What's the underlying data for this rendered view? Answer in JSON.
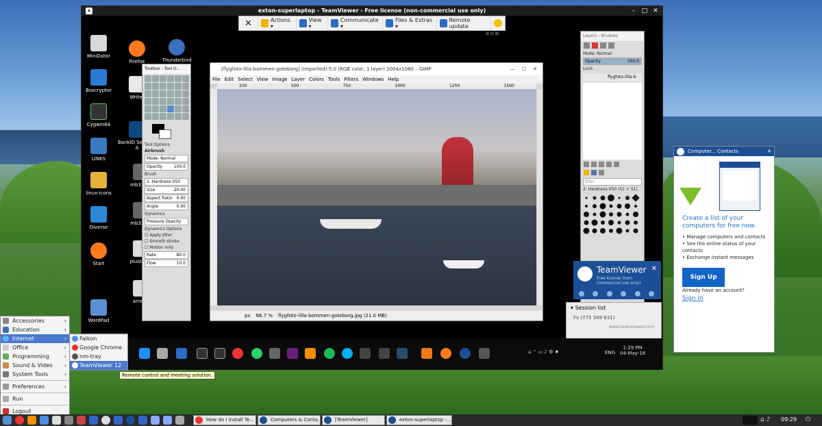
{
  "remote_window": {
    "title": "exton-superlaptop - TeamViewer - Free license (non-commercial use only)",
    "toolbar": {
      "close": "✕",
      "actions": "Actions ▾",
      "view": "View ▾",
      "communicate": "Communicate ▾",
      "files": "Files & Extras ▾",
      "update": "Remote update"
    }
  },
  "desktop_icons": [
    "MiniDator",
    "Boxcryptor",
    "Cygwin64",
    "LINKS",
    "linux-icons",
    "Diverse",
    "Start",
    "WordPad",
    "Firefox",
    "Thunderbird",
    "Writer",
    "BankID Security A",
    "mb320-b",
    "mb320-b",
    "plustoure",
    "arne-ol"
  ],
  "gimp": {
    "title": "[flygfoto-lilla-bommen-goteborg] (imported)-5.0 (RGB color, 1 layer) 2004x1080 – GIMP",
    "menu": [
      "File",
      "Edit",
      "Select",
      "View",
      "Image",
      "Layer",
      "Colors",
      "Tools",
      "Filters",
      "Windows",
      "Help"
    ],
    "ruler_ticks": [
      "250",
      "500",
      "750",
      "1000",
      "1250",
      "1500"
    ],
    "status_unit": "px",
    "status_zoom": "66.7 %",
    "status_file": "flygfoto-lilla-bommen-goteborg.jpg (21.0 MB)"
  },
  "toolbox": {
    "title": "Toolbox - Tool O...",
    "tool_options": "Tool Options",
    "tool": "Airbrush",
    "mode": "Mode: Normal",
    "opacity_label": "Opacity",
    "opacity_value": "100.0",
    "brush_label": "Brush",
    "brush_value": "2. Hardness 050",
    "size_label": "Size",
    "size_value": "20.00",
    "aspect_label": "Aspect Ratio",
    "aspect_value": "0.00",
    "angle_label": "Angle",
    "angle_value": "0.00",
    "dynamics_label": "Dynamics",
    "dynamics_value": "Pressure Opacity",
    "dyn_options": "Dynamics Options",
    "apply_jitter": "Apply Jitter",
    "smooth": "Smooth stroke",
    "motion": "Motion only",
    "rate_label": "Rate",
    "rate_value": "80.0",
    "flow_label": "Flow",
    "flow_value": "10.0"
  },
  "layers": {
    "title": "Layers – Brushes",
    "mode": "Mode: Normal",
    "opacity_label": "Opacity",
    "opacity_value": "100.0",
    "lock": "Lock:",
    "layer_name": "flygfoto-lilla-b",
    "filter": "filter",
    "brush_name": "2. Hardness 050 (51 × 51)"
  },
  "teamviewer_popup": {
    "brand": "TeamViewer",
    "license": "Free license (non-commercial use only)",
    "session_list": "Session list",
    "session_item": "Fx (775 349 631)",
    "site": "www.teamviewer.com"
  },
  "remote_taskbar": {
    "lang": "ENG",
    "time": "1:29 PM",
    "date": "04-May-18"
  },
  "contacts": {
    "title": "Computer... Contacts",
    "headline": "Create a list of your computers for free now.",
    "bullets": [
      "Manage computers and contacts",
      "See the online status of your contacts",
      "Exchange instant messages"
    ],
    "signup": "Sign Up",
    "have_account": "Already have an account?",
    "signin": "Sign In"
  },
  "app_menu": {
    "items": [
      {
        "label": "Accessories",
        "arrow": "›"
      },
      {
        "label": "Education",
        "arrow": "›"
      },
      {
        "label": "Internet",
        "arrow": "›",
        "selected": true
      },
      {
        "label": "Office",
        "arrow": "›"
      },
      {
        "label": "Programming",
        "arrow": "›"
      },
      {
        "label": "Sound & Video",
        "arrow": "›"
      },
      {
        "label": "System Tools",
        "arrow": "›"
      }
    ],
    "preferences": "Preferences",
    "run": "Run",
    "logout": "Logout"
  },
  "submenu": {
    "items": [
      {
        "label": "Falkon"
      },
      {
        "label": "Google Chrome"
      },
      {
        "label": "nm-tray"
      },
      {
        "label": "TeamViewer 12",
        "selected": true
      }
    ]
  },
  "tooltip": "Remote control and meeting solution.",
  "panel": {
    "tasks": [
      "How do I install Te...",
      "Computers & Conta...",
      "[TeamViewer]",
      "exton-superlaptop -..."
    ],
    "clock": "09:29"
  },
  "colors": {
    "tv_blue": "#1c4f96",
    "link_blue": "#1d72c8",
    "menu_select": "#4a7ad0"
  }
}
